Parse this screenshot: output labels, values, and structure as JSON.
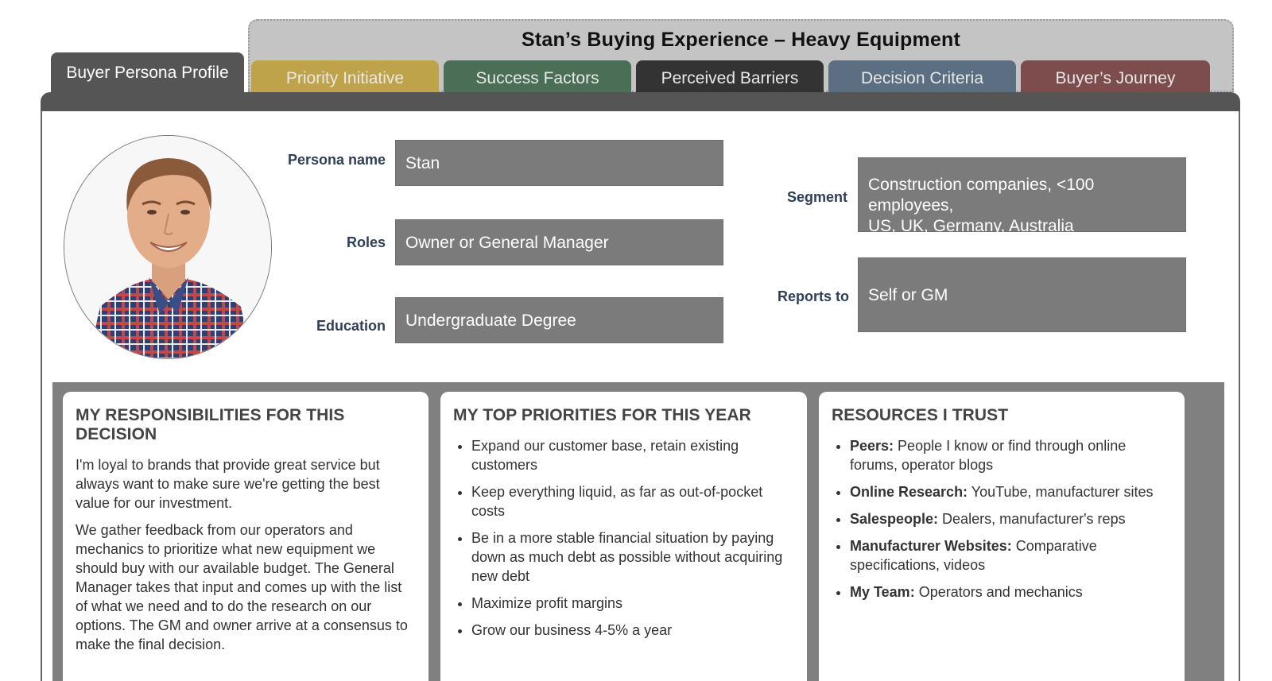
{
  "header": {
    "title": "Stan’s Buying Experience – Heavy Equipment",
    "profile_tab": "Buyer Persona Profile",
    "tabs": [
      {
        "label": "Priority Initiative",
        "color": "#bfa34a"
      },
      {
        "label": "Success Factors",
        "color": "#4a6f56"
      },
      {
        "label": "Perceived Barriers",
        "color": "#333333"
      },
      {
        "label": "Decision Criteria",
        "color": "#5b6e82"
      },
      {
        "label": "Buyer’s Journey",
        "color": "#7d4c4c"
      }
    ]
  },
  "persona": {
    "name_label": "Persona name",
    "name": "Stan",
    "roles_label": "Roles",
    "roles": "Owner or General Manager",
    "education_label": "Education",
    "education": "Undergraduate Degree",
    "segment_label": "Segment",
    "segment_line1": "Construction companies, <100 employees,",
    "segment_line2": "US, UK, Germany, Australia",
    "reports_label": "Reports to",
    "reports_to": "Self or GM"
  },
  "responsibilities": {
    "title": "MY RESPONSIBILITIES FOR THIS DECISION",
    "paragraphs": [
      "I'm loyal to brands that provide great service but always want to make sure we're getting the best value for our investment.",
      "We gather feedback from our operators and mechanics to prioritize what new equipment we should buy with our available budget. The General Manager takes that input and comes up with the list of what we need and to do the research on our options. The GM and owner arrive at a consensus to make the final decision."
    ]
  },
  "priorities": {
    "title": "MY TOP PRIORITIES FOR THIS YEAR",
    "items": [
      "Expand our customer base, retain existing customers",
      "Keep everything liquid, as far as out-of-pocket costs",
      "Be in a more stable financial situation by paying down as much debt as possible without acquiring new debt",
      "Maximize profit margins",
      "Grow our business 4-5% a year"
    ]
  },
  "resources": {
    "title": "RESOURCES I TRUST",
    "items": [
      {
        "label": "Peers:",
        "text": " People I know or find through online forums, operator blogs"
      },
      {
        "label": "Online Research:",
        "text": " YouTube, manufacturer sites"
      },
      {
        "label": "Salespeople:",
        "text": " Dealers, manufacturer's reps"
      },
      {
        "label": "Manufacturer Websites:",
        "text": " Comparative specifications, videos"
      },
      {
        "label": "My Team:",
        "text": " Operators and mechanics"
      }
    ]
  }
}
